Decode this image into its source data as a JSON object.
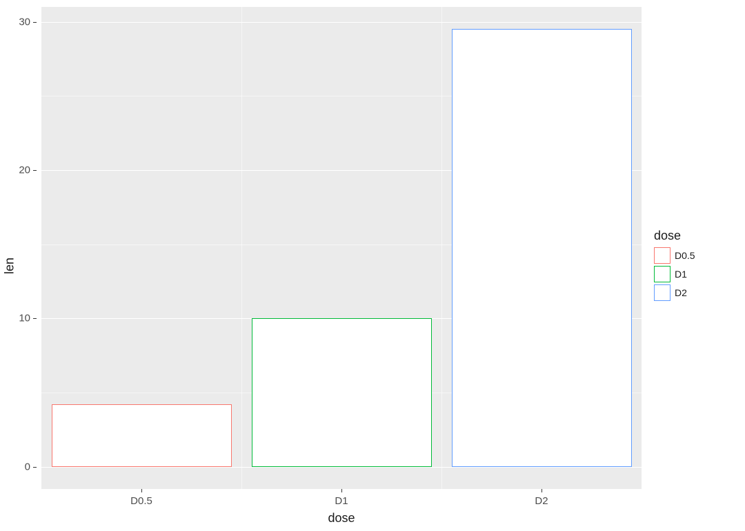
{
  "chart_data": {
    "type": "bar",
    "categories": [
      "D0.5",
      "D1",
      "D2"
    ],
    "values": [
      4.2,
      10,
      29.5
    ],
    "title": "",
    "xlabel": "dose",
    "ylabel": "len",
    "ylim": [
      -1.5,
      31
    ],
    "yticks": [
      0,
      10,
      20,
      30
    ],
    "grid": true,
    "legend": {
      "title": "dose",
      "entries": [
        {
          "label": "D0.5",
          "color": "#F8766D"
        },
        {
          "label": "D1",
          "color": "#00BA38"
        },
        {
          "label": "D2",
          "color": "#619CFF"
        }
      ]
    },
    "colors": [
      "#F8766D",
      "#00BA38",
      "#619CFF"
    ]
  }
}
